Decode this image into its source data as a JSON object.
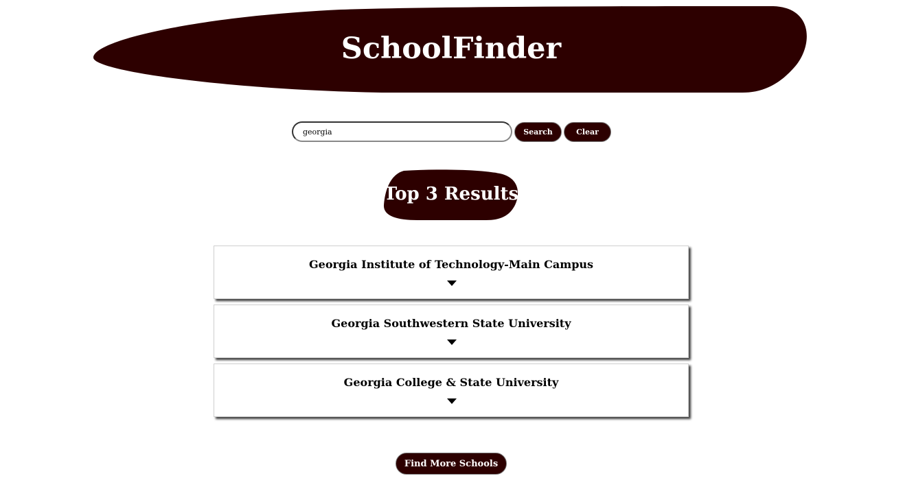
{
  "header": {
    "title": "SchoolFinder"
  },
  "search": {
    "value": "georgia",
    "search_label": "Search",
    "clear_label": "Clear"
  },
  "results": {
    "heading": "Top 3 Results",
    "items": [
      {
        "name": "Georgia Institute of Technology-Main Campus",
        "icon": "chevron-down-icon"
      },
      {
        "name": "Georgia Southwestern State University",
        "icon": "chevron-down-icon"
      },
      {
        "name": "Georgia College & State University",
        "icon": "chevron-down-icon"
      }
    ]
  },
  "footer": {
    "find_more_label": "Find More Schools"
  },
  "colors": {
    "brand": "#2d0000",
    "text_on_brand": "#ffffff",
    "background": "#ffffff"
  }
}
